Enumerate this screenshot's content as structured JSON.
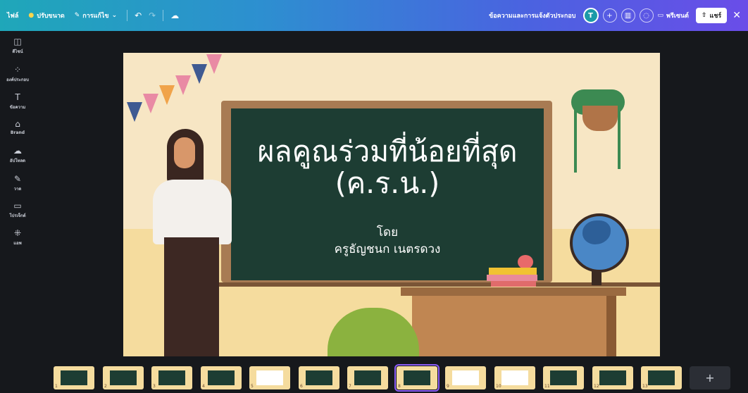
{
  "topbar": {
    "file_label": "ไฟล์",
    "resize_label": "ปรับขนาด",
    "edit_label": "การแก้ไข",
    "comments_label": "ข้อความและการแจ้งตัวประกอบ",
    "avatar_initial": "T",
    "present_label": "พรีเซนต์",
    "share_label": "แชร์"
  },
  "sidebar": {
    "items": [
      {
        "label": "ดีไซน์",
        "icon": "design-icon"
      },
      {
        "label": "องค์ประกอบ",
        "icon": "elements-icon"
      },
      {
        "label": "ข้อความ",
        "icon": "text-icon"
      },
      {
        "label": "Brand",
        "icon": "brand-icon"
      },
      {
        "label": "อัปโหลด",
        "icon": "upload-icon"
      },
      {
        "label": "วาด",
        "icon": "draw-icon"
      },
      {
        "label": "โปรเจ็กต์",
        "icon": "projects-icon"
      },
      {
        "label": "แอพ",
        "icon": "apps-icon"
      }
    ]
  },
  "slide": {
    "title_line1": "ผลคูณร่วมที่น้อยที่สุด",
    "title_line2": "(ค.ร.น.)",
    "by_label": "โดย",
    "author": "ครูธัญชนก  เนตรดวง"
  },
  "filmstrip": {
    "page_count": 13,
    "active_page": 8,
    "add_label": "+"
  },
  "colors": {
    "board": "#1d3d33",
    "board_frame": "#a87b53",
    "wall": "#f7e6c4",
    "accent_selection": "#8b5cf6"
  }
}
